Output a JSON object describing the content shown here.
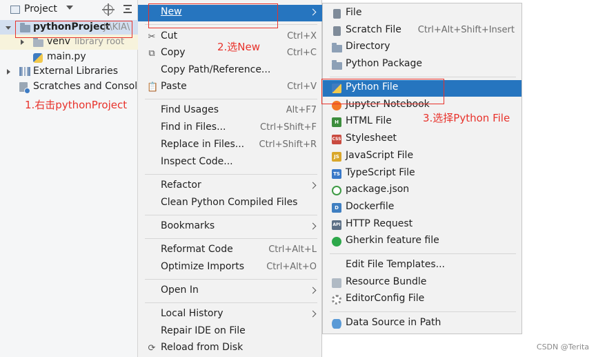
{
  "project_pane": {
    "title": "Project",
    "tree": {
      "root_name": "pythonProject",
      "root_path": "J:\\KIA\\",
      "venv_name": "venv",
      "venv_note": "library root",
      "main_file": "main.py",
      "external_libraries": "External Libraries",
      "scratches": "Scratches and Consoles"
    }
  },
  "annotations": {
    "step1": "1.右击pythonProject",
    "step2": "2.选New",
    "step3": "3.选择Python File"
  },
  "context_menu": {
    "new": "New",
    "cut": "Cut",
    "cut_shortcut": "Ctrl+X",
    "copy": "Copy",
    "copy_shortcut": "Ctrl+C",
    "copy_path": "Copy Path/Reference...",
    "paste": "Paste",
    "paste_shortcut": "Ctrl+V",
    "find_usages": "Find Usages",
    "find_usages_shortcut": "Alt+F7",
    "find_in_files": "Find in Files...",
    "find_in_files_shortcut": "Ctrl+Shift+F",
    "replace_in_files": "Replace in Files...",
    "replace_in_files_shortcut": "Ctrl+Shift+R",
    "inspect_code": "Inspect Code...",
    "refactor": "Refactor",
    "clean_compiled": "Clean Python Compiled Files",
    "bookmarks": "Bookmarks",
    "reformat_code": "Reformat Code",
    "reformat_code_shortcut": "Ctrl+Alt+L",
    "optimize_imports": "Optimize Imports",
    "optimize_imports_shortcut": "Ctrl+Alt+O",
    "open_in": "Open In",
    "local_history": "Local History",
    "repair_ide": "Repair IDE on File",
    "reload_from_disk": "Reload from Disk"
  },
  "new_submenu": {
    "file": "File",
    "scratch_file": "Scratch File",
    "scratch_file_shortcut": "Ctrl+Alt+Shift+Insert",
    "directory": "Directory",
    "python_package": "Python Package",
    "python_file": "Python File",
    "jupyter_notebook": "Jupyter Notebook",
    "html_file": "HTML File",
    "stylesheet": "Stylesheet",
    "javascript_file": "JavaScript File",
    "typescript_file": "TypeScript File",
    "package_json": "package.json",
    "dockerfile": "Dockerfile",
    "http_request": "HTTP Request",
    "gherkin": "Gherkin feature file",
    "edit_templates": "Edit File Templates...",
    "resource_bundle": "Resource Bundle",
    "editorconfig": "EditorConfig File",
    "data_source": "Data Source in Path"
  },
  "icon_text": {
    "html": "H",
    "css": "CSS",
    "js": "JS",
    "ts": "TS",
    "docker": "D",
    "api": "API"
  },
  "watermark": "CSDN @Terita",
  "colors": {
    "accent": "#2675bf",
    "annotation_red": "#e8322b",
    "selection": "#d3dff0"
  }
}
